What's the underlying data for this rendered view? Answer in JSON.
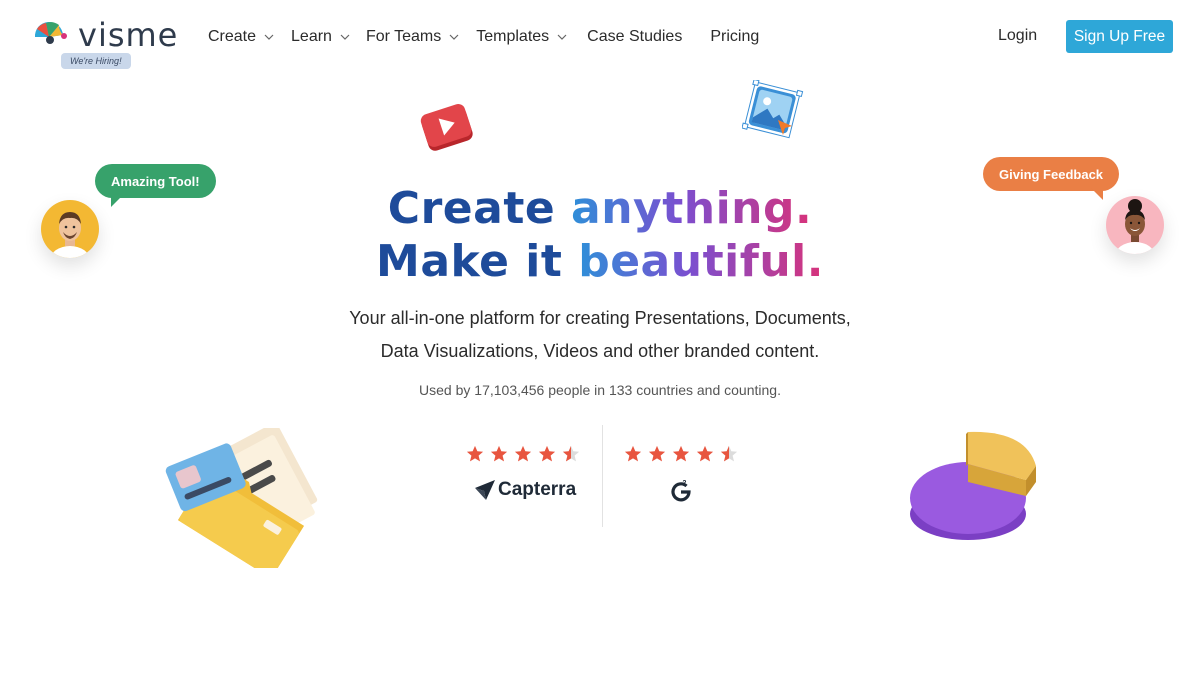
{
  "brand": {
    "name": "visme",
    "hiring_badge": "We're Hiring!"
  },
  "nav": {
    "items": [
      {
        "label": "Create",
        "has_dropdown": true
      },
      {
        "label": "Learn",
        "has_dropdown": true
      },
      {
        "label": "For Teams",
        "has_dropdown": true
      },
      {
        "label": "Templates",
        "has_dropdown": true
      },
      {
        "label": "Case Studies",
        "has_dropdown": false
      },
      {
        "label": "Pricing",
        "has_dropdown": false
      }
    ],
    "login": "Login",
    "signup": "Sign Up Free"
  },
  "hero": {
    "line1_a": "Create",
    "line1_b": "anything.",
    "line2_a": "Make it",
    "line2_b": "beautiful.",
    "subtitle_1": "Your all-in-one platform for creating Presentations, Documents,",
    "subtitle_2": "Data Visualizations, Videos and other branded content.",
    "used_by": "Used by 17,103,456 people in 133 countries and counting."
  },
  "ratings": [
    {
      "source": "Capterra",
      "stars": 4.5
    },
    {
      "source": "G2",
      "stars": 4.5
    }
  ],
  "decor": {
    "bubble_left": "Amazing Tool!",
    "bubble_right": "Giving Feedback"
  },
  "colors": {
    "accent": "#2ea7d8",
    "title_dark": "#1e4b9a",
    "star": "#e8553f",
    "bubble_green": "#37a26b",
    "bubble_orange": "#ea7f45"
  },
  "icons": [
    "chevron-down-icon",
    "play-icon",
    "image-icon",
    "folder-icon",
    "pie-chart-icon",
    "star-icon",
    "capterra-logo-icon",
    "g2-logo-icon"
  ]
}
